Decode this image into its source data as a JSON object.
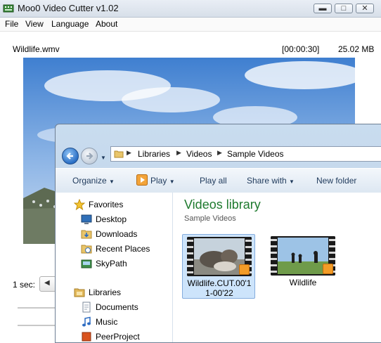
{
  "moo": {
    "title": "Moo0 Video Cutter v1.02",
    "menu": [
      "File",
      "View",
      "Language",
      "About"
    ],
    "file": {
      "name": "Wildlife.wmv",
      "duration": "[00:00:30]",
      "size": "25.02 MB"
    },
    "sec_label": "1 sec:",
    "window_controls": {
      "minimize": "minimize-icon",
      "maximize": "maximize-icon",
      "close": "close-icon"
    }
  },
  "explorer": {
    "breadcrumbs": [
      "Libraries",
      "Videos",
      "Sample Videos"
    ],
    "commands": {
      "organize": "Organize",
      "play": "Play",
      "play_all": "Play all",
      "share_with": "Share with",
      "new_folder": "New folder"
    },
    "nav": {
      "favorites_header": "Favorites",
      "favorites": [
        "Desktop",
        "Downloads",
        "Recent Places",
        "SkyPath"
      ],
      "libraries_header": "Libraries",
      "libraries": [
        "Documents",
        "Music",
        "PeerProject"
      ]
    },
    "library": {
      "title": "Videos library",
      "subtitle": "Sample Videos"
    },
    "files": [
      {
        "name_line1": "Wildlife.CUT.00'1",
        "name_line2": "1-00'22"
      },
      {
        "name_line1": "Wildlife",
        "name_line2": ""
      }
    ],
    "colors": {
      "library_title": "#1e7a2e",
      "selection": "#cde4fb"
    }
  }
}
